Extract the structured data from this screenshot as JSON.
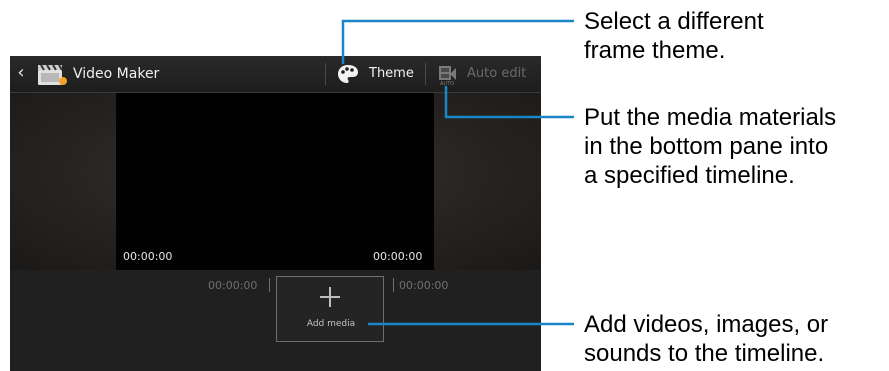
{
  "app": {
    "title": "Video Maker",
    "back_icon": "chevron-left-icon",
    "app_icon": "clapperboard-icon"
  },
  "toolbar": {
    "theme_label": "Theme",
    "theme_icon": "palette-icon",
    "auto_edit_label": "Auto edit",
    "auto_edit_icon": "film-auto-edit-icon"
  },
  "preview": {
    "start_time": "00:00:00",
    "end_time": "00:00:00"
  },
  "timeline": {
    "left_time": "00:00:00",
    "right_time": "00:00:00",
    "add_media_label": "Add media"
  },
  "callouts": {
    "theme": [
      "Select a different",
      "frame theme."
    ],
    "auto_edit": [
      "Put the media materials",
      "in the bottom pane into",
      "a specified timeline."
    ],
    "add_media": [
      "Add videos, images, or",
      "sounds to the timeline."
    ]
  },
  "colors": {
    "leader_line": "#1a86c7",
    "screen_background": "#141414",
    "disabled_text": "#6a6a6a"
  }
}
